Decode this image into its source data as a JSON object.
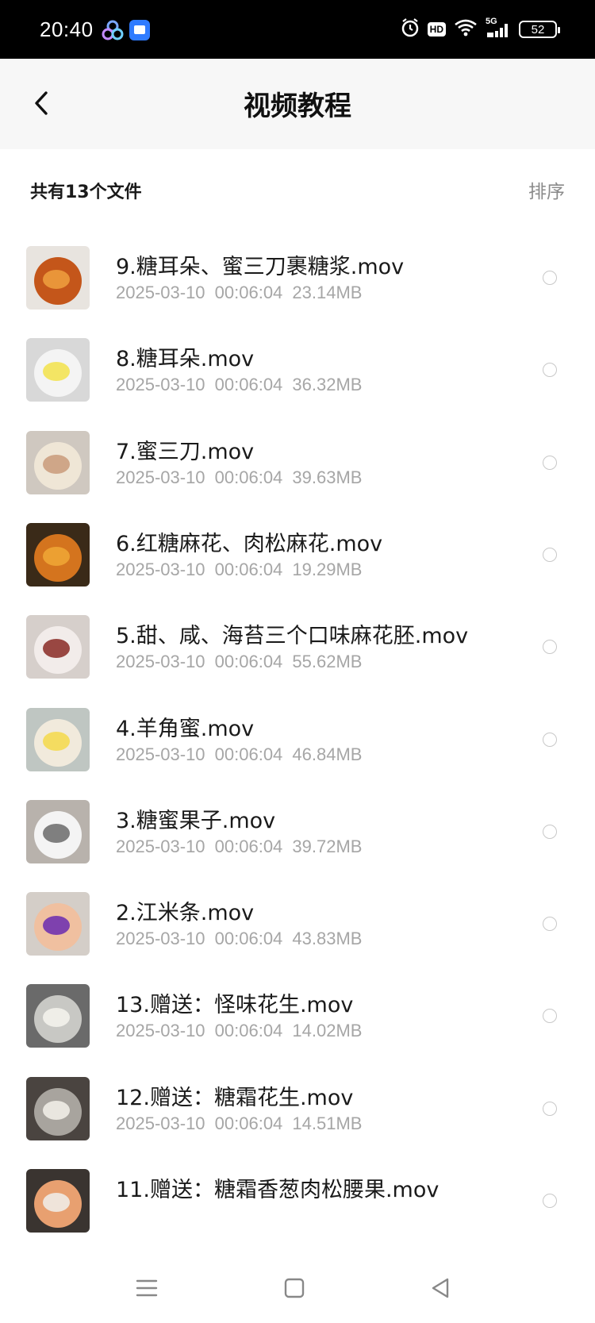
{
  "status_bar": {
    "time": "20:40",
    "battery": "52",
    "signal_label": "5G",
    "hd_label": "HD"
  },
  "header": {
    "title": "视频教程",
    "back_icon": "chevron-left-icon"
  },
  "subheader": {
    "count_text": "共有13个文件",
    "sort_label": "排序"
  },
  "files": [
    {
      "name": "9.糖耳朵、蜜三刀裹糖浆.mov",
      "meta": "2025-03-10  00:06:04  23.14MB",
      "thumb": "food-thumbnail"
    },
    {
      "name": "8.糖耳朵.mov",
      "meta": "2025-03-10  00:06:04  36.32MB",
      "thumb": "food-thumbnail"
    },
    {
      "name": "7.蜜三刀.mov",
      "meta": "2025-03-10  00:06:04  39.63MB",
      "thumb": "food-thumbnail"
    },
    {
      "name": "6.红糖麻花、肉松麻花.mov",
      "meta": "2025-03-10  00:06:04  19.29MB",
      "thumb": "food-thumbnail"
    },
    {
      "name": "5.甜、咸、海苔三个口味麻花胚.mov",
      "meta": "2025-03-10  00:06:04  55.62MB",
      "thumb": "food-thumbnail"
    },
    {
      "name": "4.羊角蜜.mov",
      "meta": "2025-03-10  00:06:04  46.84MB",
      "thumb": "food-thumbnail"
    },
    {
      "name": "3.糖蜜果子.mov",
      "meta": "2025-03-10  00:06:04  39.72MB",
      "thumb": "food-thumbnail"
    },
    {
      "name": "2.江米条.mov",
      "meta": "2025-03-10  00:06:04  43.83MB",
      "thumb": "food-thumbnail"
    },
    {
      "name": "13.赠送：怪味花生.mov",
      "meta": "2025-03-10  00:06:04  14.02MB",
      "thumb": "food-thumbnail"
    },
    {
      "name": "12.赠送：糖霜花生.mov",
      "meta": "2025-03-10  00:06:04  14.51MB",
      "thumb": "food-thumbnail"
    },
    {
      "name": "11.赠送：糖霜香葱肉松腰果.mov",
      "meta": "",
      "thumb": "food-thumbnail"
    }
  ],
  "nav": {
    "menu_icon": "menu-icon",
    "home_icon": "square-icon",
    "back_icon": "triangle-back-icon"
  },
  "colors": {
    "meta_gray": "#a6a6a6",
    "title_bar_bg": "#f7f7f7",
    "status_bg": "#000000"
  }
}
